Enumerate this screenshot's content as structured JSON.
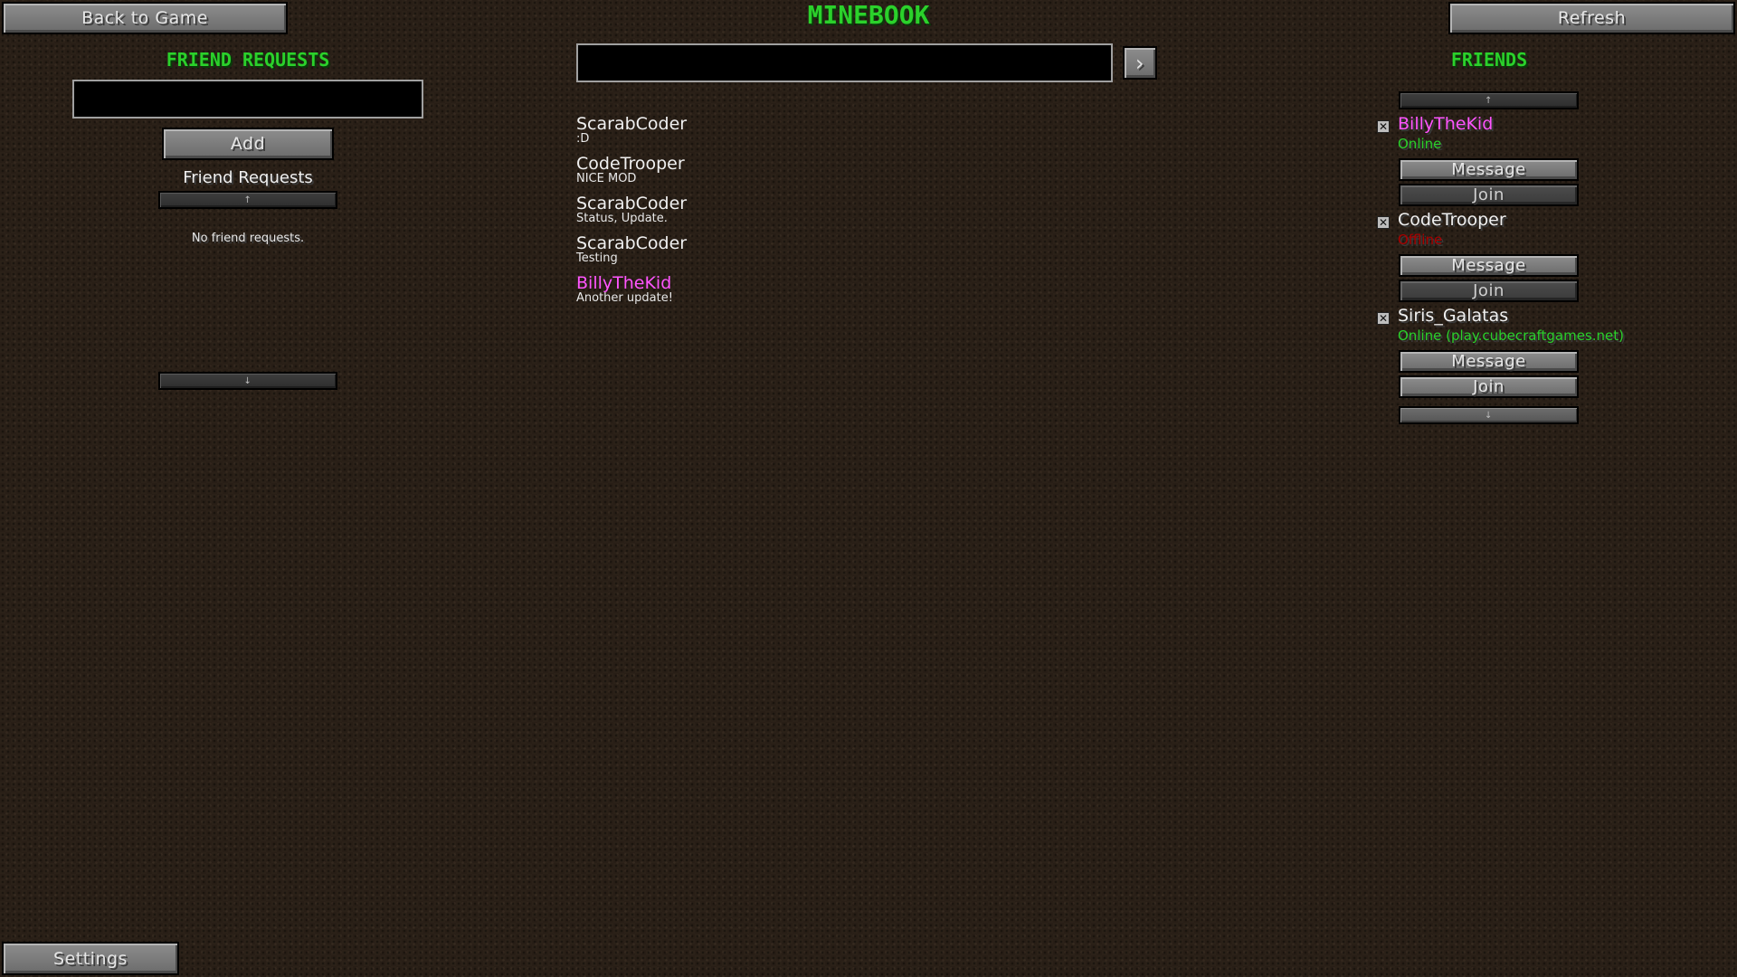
{
  "header": {
    "title": "MINEBOOK",
    "back_label": "Back to Game",
    "refresh_label": "Refresh",
    "settings_label": "Settings"
  },
  "friend_requests": {
    "heading": "FRIEND REQUESTS",
    "input_value": "",
    "add_label": "Add",
    "list_title": "Friend Requests",
    "scroll_up": "↑",
    "scroll_down": "↓",
    "empty_text": "No friend requests."
  },
  "feed": {
    "input_value": "",
    "submit_glyph": "›",
    "posts": [
      {
        "name": "ScarabCoder",
        "status": ":D",
        "name_color": "#f0f0f0"
      },
      {
        "name": "CodeTrooper",
        "status": "NICE MOD",
        "name_color": "#f0f0f0"
      },
      {
        "name": "ScarabCoder",
        "status": "Status, Update.",
        "name_color": "#f0f0f0"
      },
      {
        "name": "ScarabCoder",
        "status": "Testing",
        "name_color": "#f0f0f0"
      },
      {
        "name": "BillyTheKid",
        "status": "Another update!",
        "name_color": "#ff55ff"
      }
    ]
  },
  "friends": {
    "heading": "FRIENDS",
    "scroll_up": "↑",
    "scroll_down": "↓",
    "message_label": "Message",
    "join_label": "Join",
    "remove_glyph": "✕",
    "items": [
      {
        "name": "BillyTheKid",
        "name_color": "#ff55ff",
        "status": "Online",
        "status_color": "#2bd12b"
      },
      {
        "name": "CodeTrooper",
        "name_color": "#f0f0f0",
        "status": "Offline",
        "status_color": "#aa0000"
      },
      {
        "name": "Siris_Galatas",
        "name_color": "#f0f0f0",
        "status": "Online (play.cubecraftgames.net)",
        "status_color": "#2bd12b"
      }
    ]
  },
  "colors": {
    "heading_green": "#2bd12b",
    "online_green": "#2bd12b",
    "offline_red": "#aa0000",
    "highlight_pink": "#ff55ff"
  }
}
